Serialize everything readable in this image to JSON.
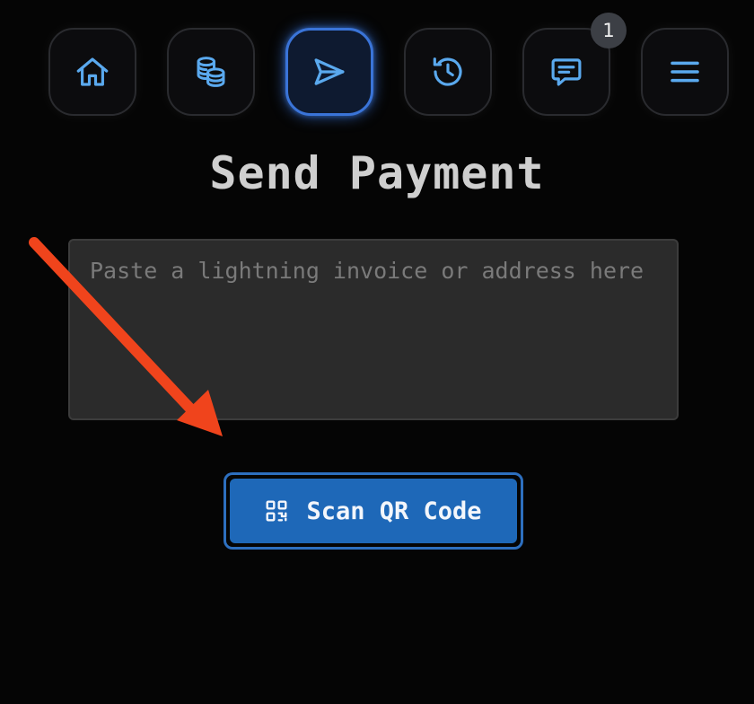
{
  "nav": {
    "items": [
      {
        "name": "home",
        "icon": "home-icon"
      },
      {
        "name": "coins",
        "icon": "coins-icon"
      },
      {
        "name": "send",
        "icon": "send-icon",
        "active": true
      },
      {
        "name": "history",
        "icon": "history-icon"
      },
      {
        "name": "messages",
        "icon": "message-icon",
        "badge": "1"
      },
      {
        "name": "menu",
        "icon": "menu-icon"
      }
    ]
  },
  "page": {
    "title": "Send Payment"
  },
  "invoice_input": {
    "value": "",
    "placeholder": "Paste a lightning invoice or address here"
  },
  "scan_button": {
    "label": "Scan QR Code",
    "icon": "qr-code-icon"
  },
  "annotation": {
    "icon": "red-arrow-icon",
    "color": "#f0441c"
  },
  "colors": {
    "background": "#050505",
    "accent": "#1e68b8",
    "icon": "#5aa9ee",
    "active_border": "#3a74d8",
    "title": "#cfcfcf"
  }
}
